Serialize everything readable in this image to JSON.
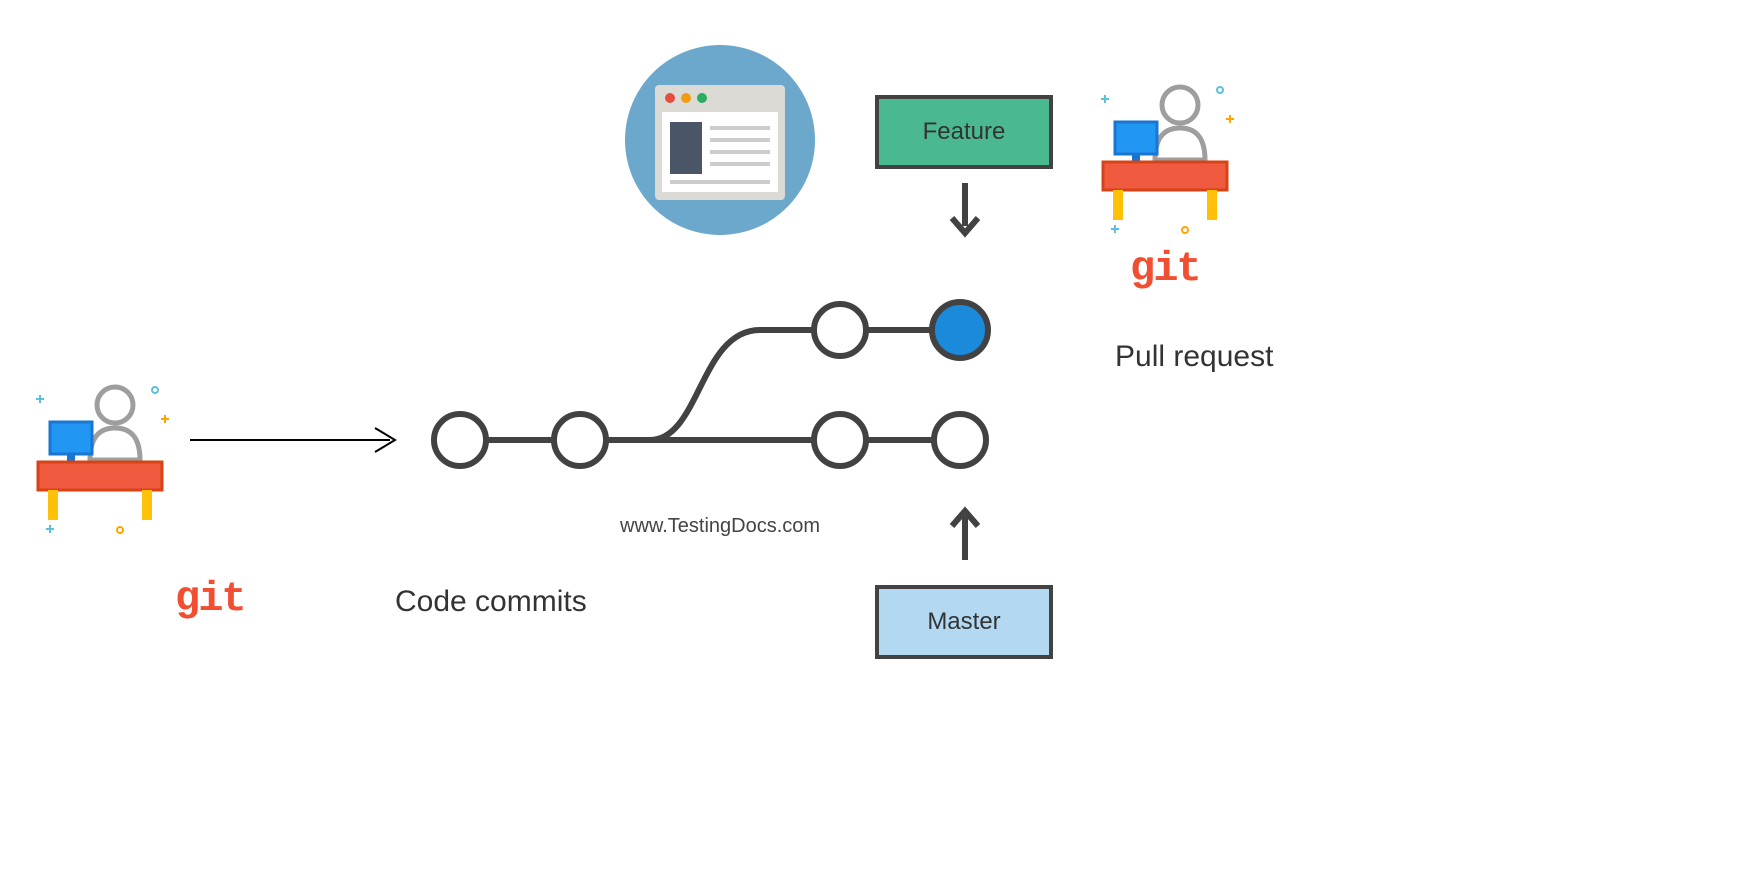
{
  "labels": {
    "feature": "Feature",
    "master": "Master",
    "code_commits": "Code commits",
    "pull_request": "Pull request",
    "watermark": "www.TestingDocs.com",
    "git": "git"
  },
  "colors": {
    "git_red": "#f14e32",
    "feature_green": "#4bb98f",
    "master_blue": "#b3d9f2",
    "node_fill_blue": "#1c8adb",
    "webpage_circle": "#6ba8cc",
    "webpage_header": "#dcdad4",
    "webpage_body": "#ffffff",
    "webpage_sidebar": "#4a5568",
    "desk_red": "#f05a3e",
    "monitor_blue": "#2196f3",
    "desk_legs": "#ffc107",
    "person_outline": "#9e9e9e",
    "line": "#424242",
    "sparkle_blue": "#5bc0de",
    "sparkle_orange": "#ffa500"
  },
  "diagram": {
    "type": "git-branch-diagram",
    "branches": [
      {
        "name": "master",
        "nodes": 4,
        "color": "white"
      },
      {
        "name": "feature",
        "nodes": 2,
        "last_node_filled": true
      }
    ],
    "arrows": [
      {
        "from": "developer-left",
        "to": "commit-graph"
      },
      {
        "from": "feature-box",
        "to": "feature-branch",
        "direction": "down"
      },
      {
        "from": "master-box",
        "to": "master-branch",
        "direction": "up"
      }
    ]
  }
}
